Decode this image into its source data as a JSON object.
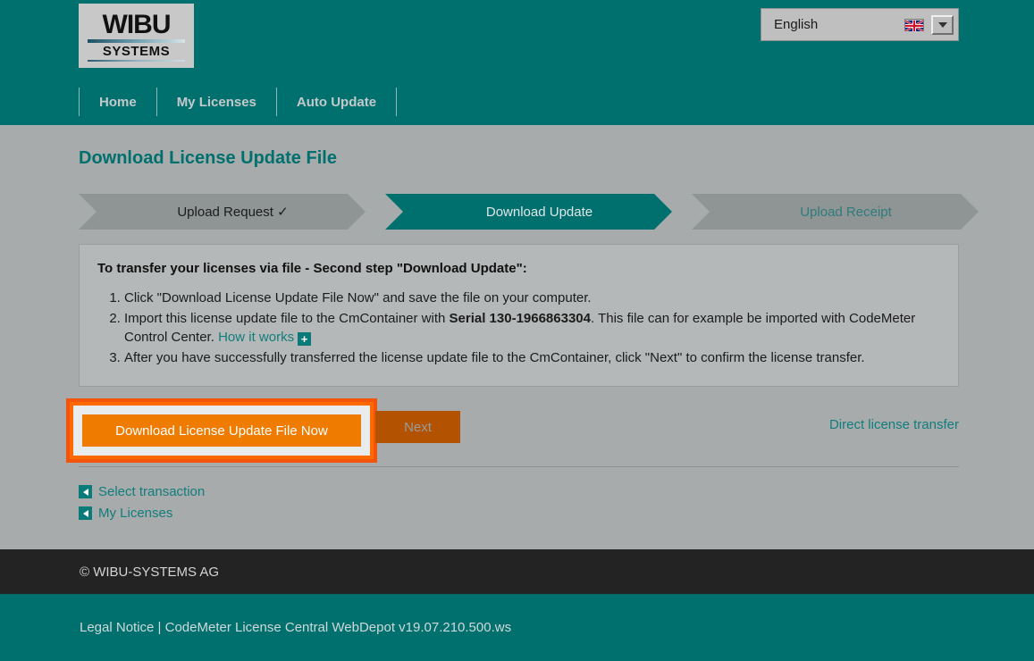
{
  "header": {
    "logo": {
      "line1": "WIBU",
      "line2": "SYSTEMS"
    },
    "language": {
      "label": "English",
      "flag_icon": "uk-flag-icon",
      "dropdown_icon": "chevron-down-icon"
    },
    "nav": [
      {
        "label": "Home"
      },
      {
        "label": "My Licenses"
      },
      {
        "label": "Auto Update"
      }
    ]
  },
  "main": {
    "page_title": "Download License Update File",
    "steps": [
      {
        "label": "Upload Request ✓",
        "state": "done"
      },
      {
        "label": "Download Update",
        "state": "active"
      },
      {
        "label": "Upload Receipt",
        "state": "upcoming"
      }
    ],
    "panel": {
      "title": "To transfer your licenses via file - Second step \"Download Update\":",
      "items": [
        {
          "pre": "Click \"Download License Update File Now\" and save the file on your computer.",
          "bold": "",
          "post": "",
          "link": "",
          "link_icon": ""
        },
        {
          "pre": "Import this license update file to the CmContainer with ",
          "bold": "Serial 130-1966863304",
          "post": ". This file can for example be imported with CodeMeter Control Center. ",
          "link": "How it works",
          "link_icon": "plus-expand-icon"
        },
        {
          "pre": "After you have successfully transferred the license update file to the CmContainer, click \"Next\" to confirm the license transfer.",
          "bold": "",
          "post": "",
          "link": "",
          "link_icon": ""
        }
      ]
    },
    "actions": {
      "download_label": "Download License Update File Now",
      "next_label": "Next",
      "direct_transfer_label": "Direct license transfer",
      "highlight_color": "#f2540c",
      "download_color": "#ef7c00",
      "next_color": "#b35200"
    },
    "backlinks": [
      {
        "label": "Select transaction",
        "icon": "arrow-left-icon"
      },
      {
        "label": "My Licenses",
        "icon": "arrow-left-icon"
      }
    ]
  },
  "footer": {
    "copyright": "© WIBU-SYSTEMS AG",
    "legal_label": "Legal Notice",
    "separator": " | ",
    "version_text": "CodeMeter License Central WebDepot v19.07.210.500.ws"
  },
  "colors": {
    "teal": "#00706f",
    "body_gray": "#a7abab",
    "panel_gray": "#b5b8b8",
    "link_teal": "#117d7c",
    "footer_dark": "#232323"
  }
}
